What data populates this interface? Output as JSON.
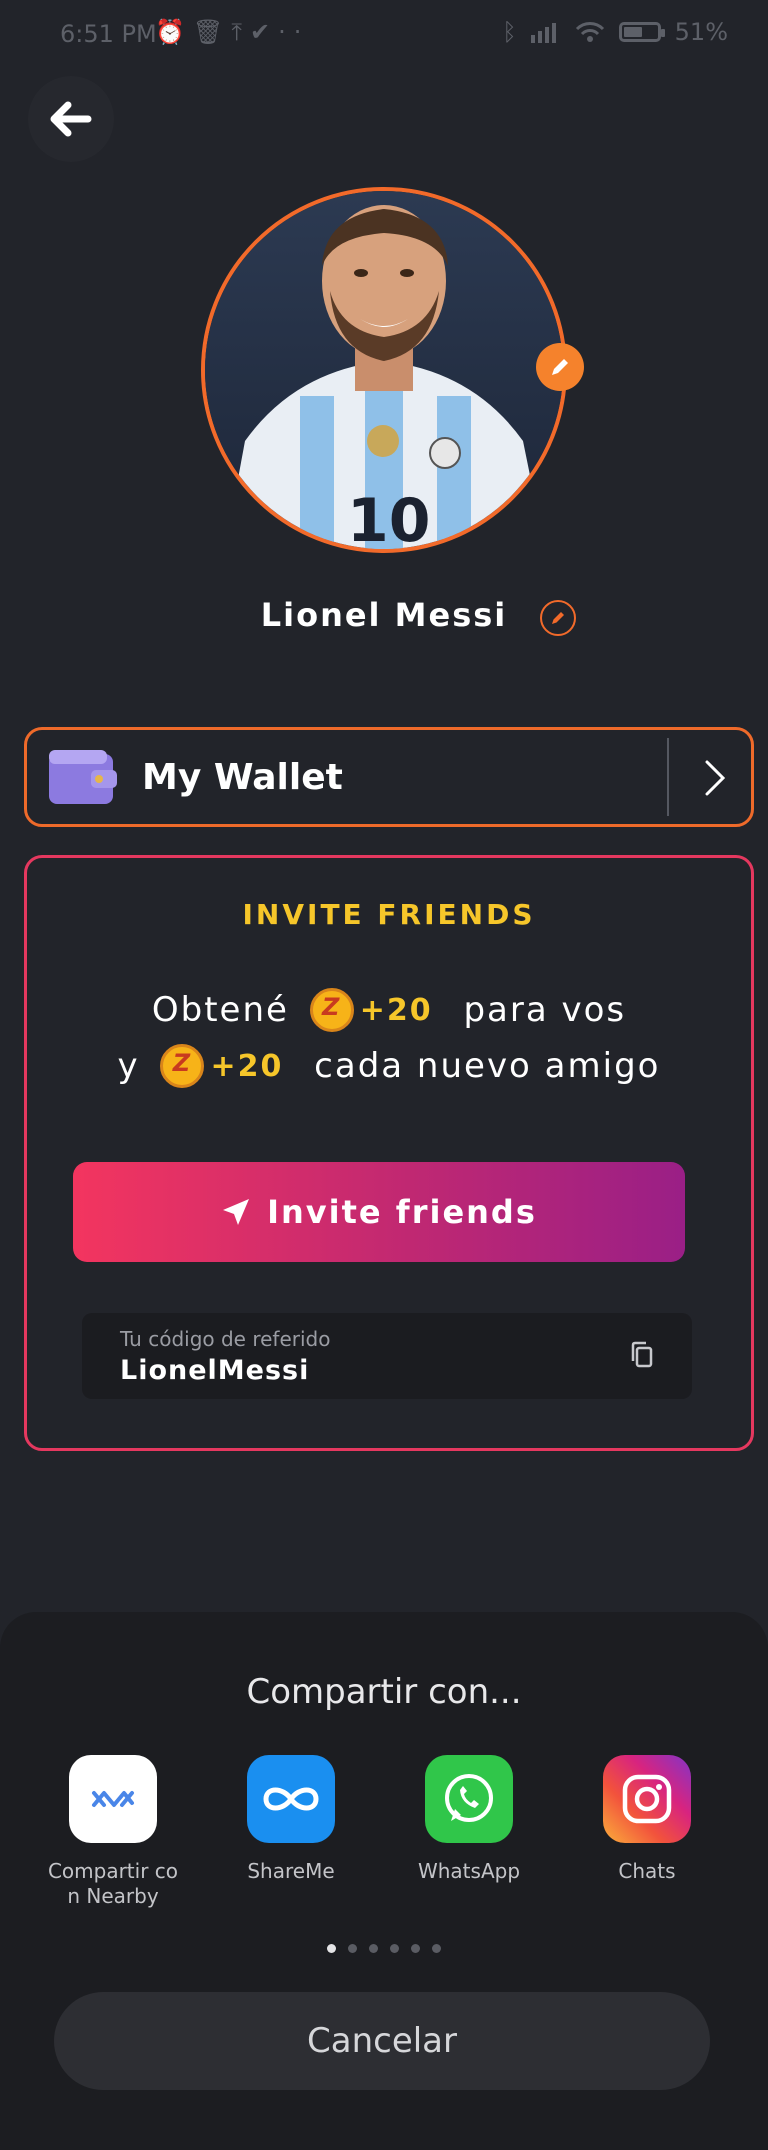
{
  "status_bar": {
    "time": "6:51 PM",
    "notification_icons": [
      "alarm-icon",
      "trash-icon",
      "upload-icon",
      "check-icon",
      "more-dots-icon"
    ],
    "battery": "51%"
  },
  "profile": {
    "name": "Lionel Messi",
    "avatar_ring_color": "#f26a2a"
  },
  "wallet": {
    "label": "My Wallet"
  },
  "invite": {
    "title": "INVITE FRIENDS",
    "line1_prefix": "Obtené",
    "line1_bonus": "+20",
    "line1_suffix": "para vos",
    "line2_prefix": "y",
    "line2_bonus": "+20",
    "line2_suffix": "cada nuevo amigo",
    "coin_letter": "Z",
    "button_label": "Invite friends",
    "referral_hint": "Tu código de referido",
    "referral_code": "LionelMessi"
  },
  "share_sheet": {
    "title": "Compartir con...",
    "apps": [
      {
        "label_line1": "Compartir co",
        "label_line2": "n Nearby",
        "icon": "nearby-share-icon"
      },
      {
        "label_line1": "ShareMe",
        "label_line2": "",
        "icon": "shareme-icon"
      },
      {
        "label_line1": "WhatsApp",
        "label_line2": "",
        "icon": "whatsapp-icon"
      },
      {
        "label_line1": "Chats",
        "label_line2": "",
        "icon": "instagram-icon"
      }
    ],
    "page_count": 6,
    "current_page": 1,
    "cancel_label": "Cancelar"
  },
  "colors": {
    "background": "#22242a",
    "accent_orange": "#ee6a2a",
    "invite_border": "#e5385f",
    "gold": "#f6c62a"
  }
}
